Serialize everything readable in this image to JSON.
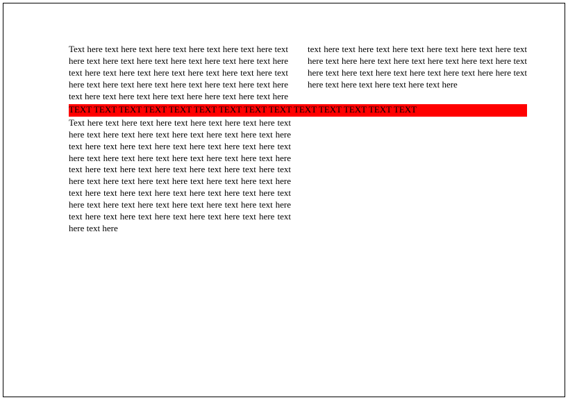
{
  "document": {
    "two_column_text": "Text here text here text here text here text here text here text here text here text here text here text here text here text here text here text here text here text here text here text here text here text here text here text here text here text here text here text here text here text here text here here text here text here text here text here text here text here text here text here text here text here here text here text here text here text here text here text here text here text here text here text here here text here text here text here text here text here",
    "red_band_text": "TEXT TEXT TEXT TEXT TEXT TEXT TEXT TEXT TEXT TEXT TEXT TEXT TEXT TEXT",
    "single_column_text": "Text here text here text here text here text here text here text here text here text here text here text here text here text here text here text here text here text here text here text here text here text here text here text here text here text here text here text here text here text here text here text here text here text here text here text here text here text here text here text here text here text here text here text here text here text here text here text here text here text here text here text here text here text here text here text here text here text here text here text here text here"
  },
  "colors": {
    "highlight": "#ff0000"
  }
}
